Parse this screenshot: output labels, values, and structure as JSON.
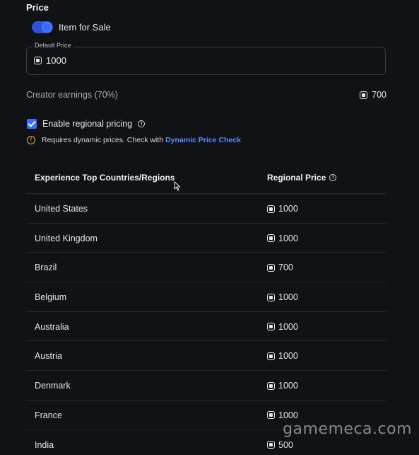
{
  "section": {
    "title": "Price"
  },
  "sale": {
    "toggle_on": true,
    "label": "Item for Sale"
  },
  "default_price": {
    "label": "Default Price",
    "value": "1000",
    "icon": "robux-icon"
  },
  "earnings": {
    "label": "Creator earnings (70%)",
    "value": "700",
    "icon": "robux-icon"
  },
  "regional": {
    "checked": true,
    "label": "Enable regional pricing",
    "warning_text": "Requires dynamic prices. Check with ",
    "warning_link": "Dynamic Price Check"
  },
  "table": {
    "headers": {
      "country": "Experience Top Countries/Regions",
      "price": "Regional Price"
    },
    "rows": [
      {
        "country": "United States",
        "price": "1000"
      },
      {
        "country": "United Kingdom",
        "price": "1000"
      },
      {
        "country": "Brazil",
        "price": "700"
      },
      {
        "country": "Belgium",
        "price": "1000"
      },
      {
        "country": "Australia",
        "price": "1000"
      },
      {
        "country": "Austria",
        "price": "1000"
      },
      {
        "country": "Denmark",
        "price": "1000"
      },
      {
        "country": "France",
        "price": "1000"
      },
      {
        "country": "India",
        "price": "500"
      }
    ]
  },
  "watermark": "gamemeca.com",
  "colors": {
    "accent": "#3b6cff",
    "link": "#5f8cff",
    "warning": "#e5b23a",
    "background": "#111216"
  }
}
